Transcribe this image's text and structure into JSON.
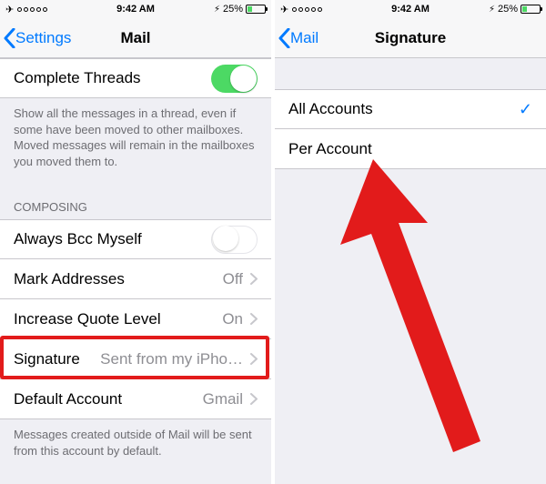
{
  "status": {
    "time": "9:42 AM",
    "battery_pct": "25%"
  },
  "left": {
    "back_label": "Settings",
    "title": "Mail",
    "threads_label": "Complete Threads",
    "threads_footer": "Show all the messages in a thread, even if some have been moved to other mailboxes. Moved messages will remain in the mailboxes you moved them to.",
    "composing_header": "COMPOSING",
    "bcc_label": "Always Bcc Myself",
    "mark_label": "Mark Addresses",
    "mark_value": "Off",
    "quote_label": "Increase Quote Level",
    "quote_value": "On",
    "signature_label": "Signature",
    "signature_value": "Sent from my iPho…",
    "default_label": "Default Account",
    "default_value": "Gmail",
    "default_footer": "Messages created outside of Mail will be sent from this account by default."
  },
  "right": {
    "back_label": "Mail",
    "title": "Signature",
    "all_label": "All Accounts",
    "per_label": "Per Account"
  }
}
